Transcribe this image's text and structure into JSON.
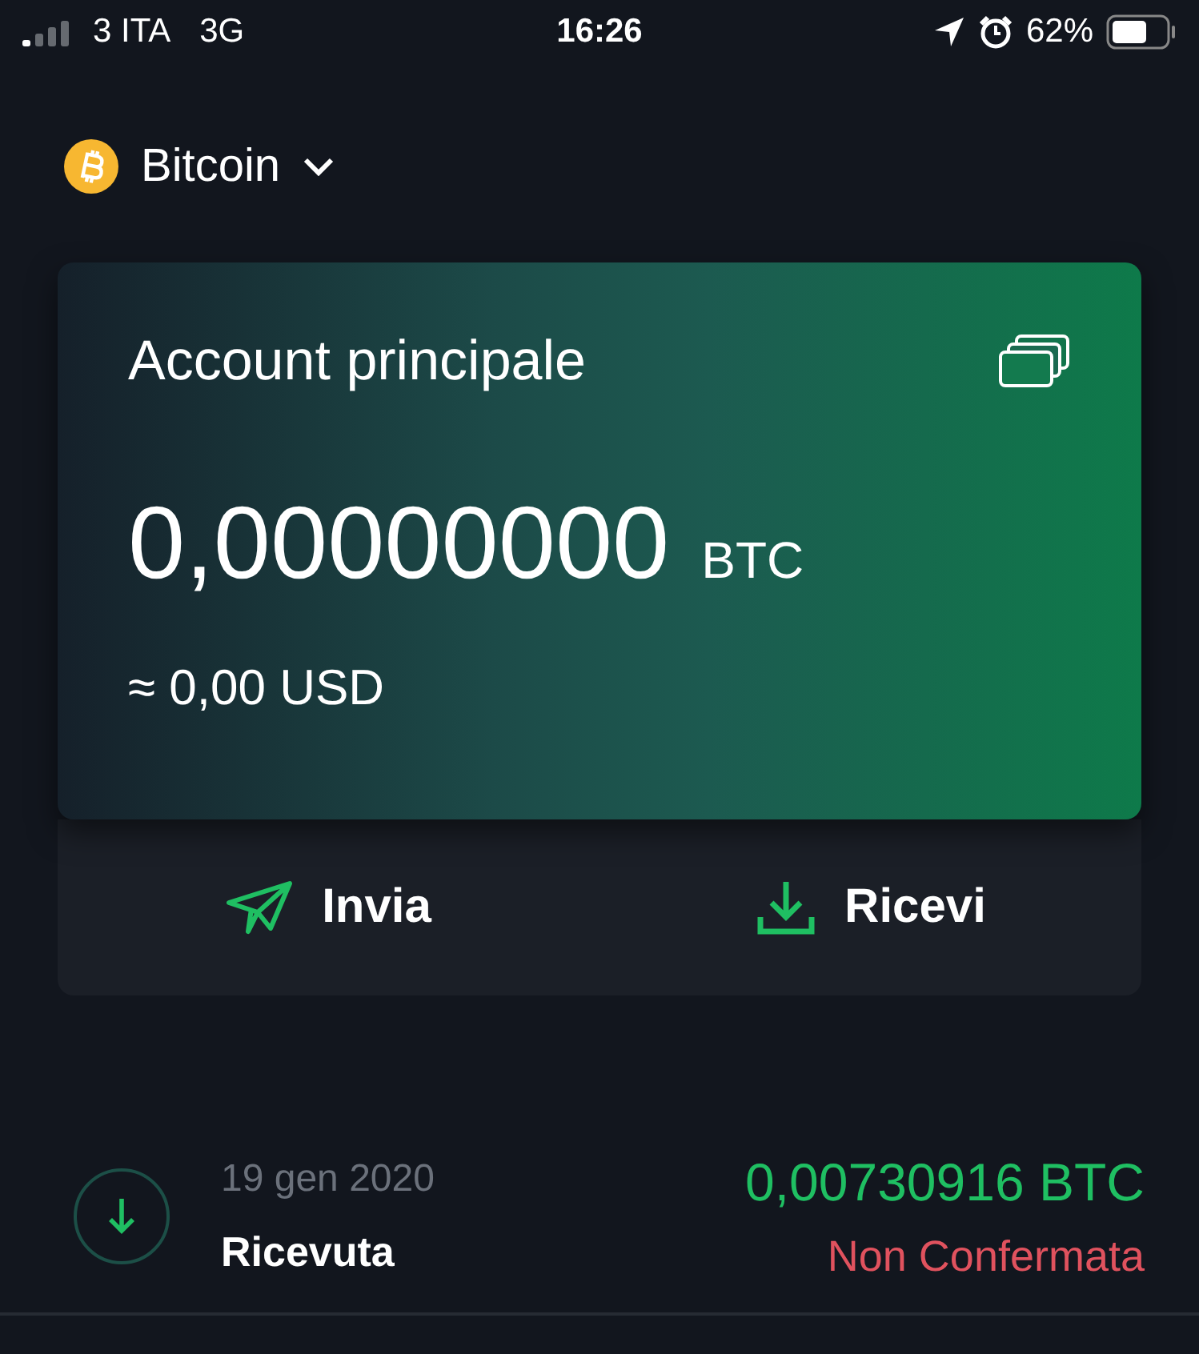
{
  "status_bar": {
    "carrier": "3 ITA",
    "network": "3G",
    "time": "16:26",
    "battery": "62%"
  },
  "header": {
    "title": "Bitcoin"
  },
  "account_card": {
    "name": "Account principale",
    "balance": "0,00000000",
    "unit": "BTC",
    "fiat": "≈ 0,00 USD"
  },
  "actions": [
    {
      "kind": "send",
      "label": "Invia"
    },
    {
      "kind": "receive",
      "label": "Ricevi"
    }
  ],
  "transactions": [
    {
      "kind": "received",
      "date": "19 gen 2020",
      "label": "Ricevuta",
      "amount": "0,00730916 BTC",
      "status": "Non Confermata",
      "confirmed": false
    }
  ]
}
